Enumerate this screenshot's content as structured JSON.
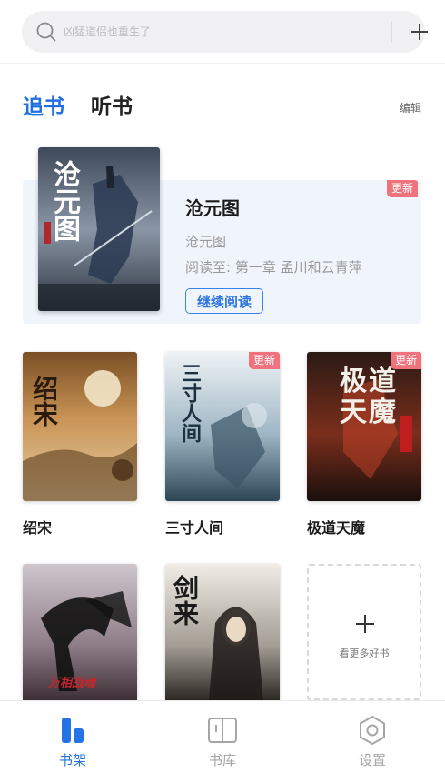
{
  "search": {
    "placeholder": "凶猛道侣也重生了",
    "add_icon": "plus-icon",
    "search_icon": "search-icon"
  },
  "tabs": [
    {
      "label": "追书",
      "active": true
    },
    {
      "label": "听书",
      "active": false
    }
  ],
  "edit_label": "编辑",
  "featured": {
    "title": "沧元图",
    "author": "沧元图",
    "progress": "阅读至: 第一章 孟川和云青萍",
    "continue_label": "继续阅读",
    "badge": "更新",
    "cover_text": "沧元图"
  },
  "books": [
    {
      "title": "绍宋",
      "cover_text": "绍宋",
      "badge": ""
    },
    {
      "title": "三寸人间",
      "cover_text": "三寸人间",
      "badge": "更新"
    },
    {
      "title": "极道天魔",
      "cover_text": "极道天魔",
      "badge": "更新"
    },
    {
      "title": "",
      "cover_text": "万相战魂",
      "badge": ""
    },
    {
      "title": "",
      "cover_text": "剑来",
      "badge": ""
    }
  ],
  "more_books": {
    "label": "看更多好书",
    "icon": "plus-icon"
  },
  "nav": [
    {
      "label": "书架",
      "icon": "bookshelf-icon",
      "active": true
    },
    {
      "label": "书库",
      "icon": "book-library-icon",
      "active": false
    },
    {
      "label": "设置",
      "icon": "settings-hexagon-icon",
      "active": false
    }
  ],
  "colors": {
    "accent": "#1f6fe0",
    "badge": "#f0727d",
    "featured_bg": "#f0f5fc"
  }
}
